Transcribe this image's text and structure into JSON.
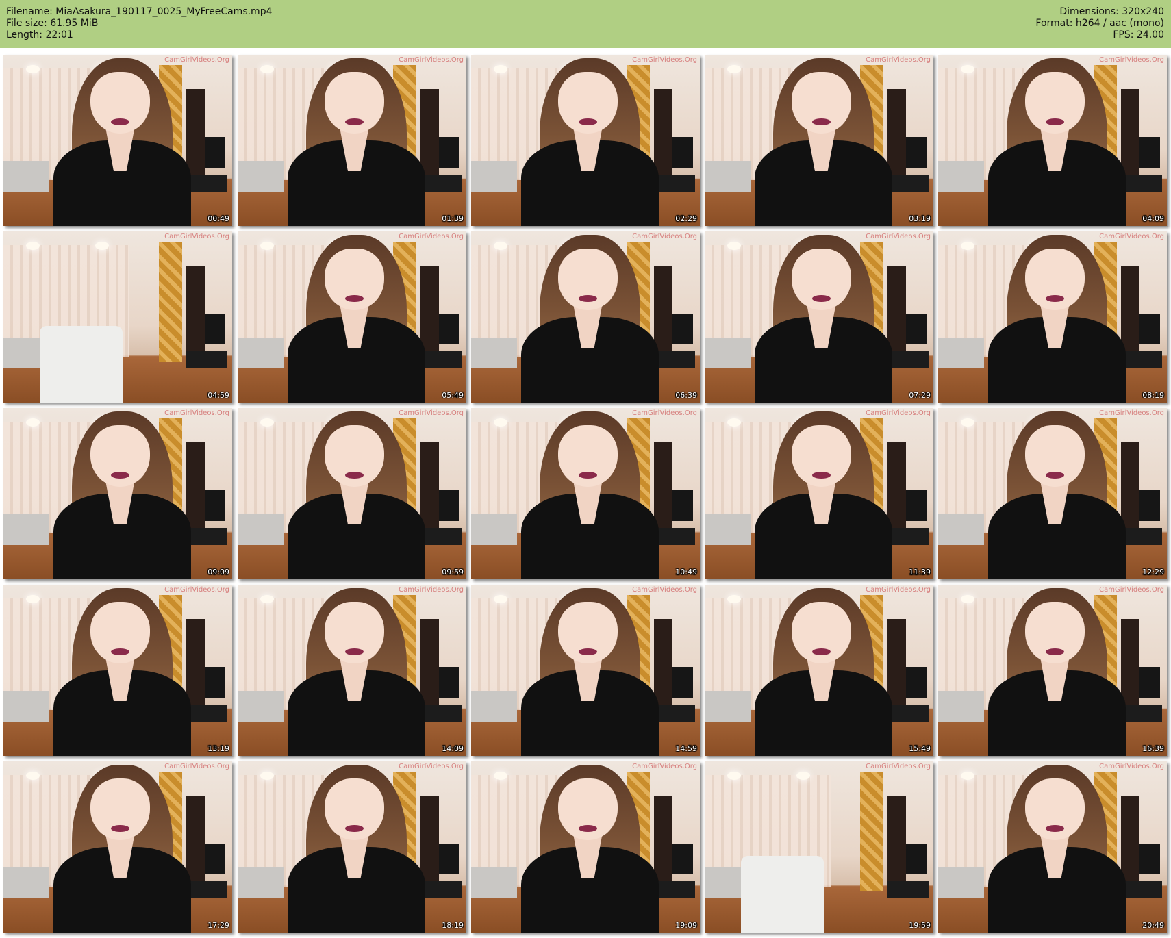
{
  "header": {
    "filename": "Filename: MiaAsakura_190117_0025_MyFreeCams.mp4",
    "filesize": "File size: 61.95 MiB",
    "length": "Length: 22:01",
    "dimensions": "Dimensions: 320x240",
    "format": "Format: h264 / aac (mono)",
    "fps": "FPS: 24.00"
  },
  "colors": {
    "header_bg": "#b0cf83"
  },
  "watermark": "CamGirlVideos.Org",
  "thumbnails": [
    {
      "ts": "00:49"
    },
    {
      "ts": "01:39"
    },
    {
      "ts": "02:29"
    },
    {
      "ts": "03:19"
    },
    {
      "ts": "04:09"
    },
    {
      "ts": "04:59"
    },
    {
      "ts": "05:49"
    },
    {
      "ts": "06:39"
    },
    {
      "ts": "07:29"
    },
    {
      "ts": "08:19"
    },
    {
      "ts": "09:09"
    },
    {
      "ts": "09:59"
    },
    {
      "ts": "10:49"
    },
    {
      "ts": "11:39"
    },
    {
      "ts": "12:29"
    },
    {
      "ts": "13:19"
    },
    {
      "ts": "14:09"
    },
    {
      "ts": "14:59"
    },
    {
      "ts": "15:49"
    },
    {
      "ts": "16:39"
    },
    {
      "ts": "17:29"
    },
    {
      "ts": "18:19"
    },
    {
      "ts": "19:09"
    },
    {
      "ts": "19:59"
    },
    {
      "ts": "20:49"
    }
  ]
}
